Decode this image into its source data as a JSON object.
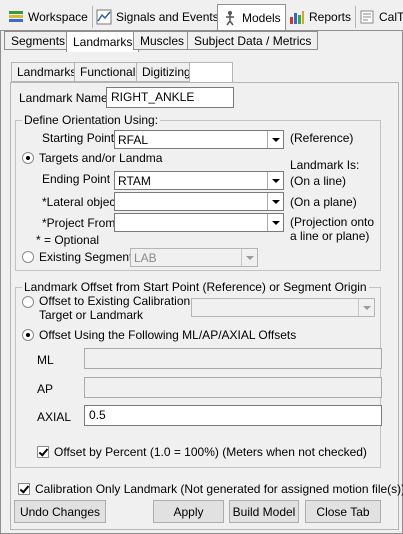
{
  "top_tabs": [
    {
      "label": "Workspace",
      "icon": "workspace-icon"
    },
    {
      "label": "Signals and Events",
      "icon": "signals-icon"
    },
    {
      "label": "Models",
      "icon": "models-icon"
    },
    {
      "label": "Reports",
      "icon": "reports-icon"
    },
    {
      "label": "CalT",
      "icon": "calibration-icon"
    }
  ],
  "model_tabs": [
    "Segments",
    "Landmarks",
    "Muscles",
    "Subject Data / Metrics"
  ],
  "landmark_tabs": [
    "Landmarks",
    "Functional",
    "Digitizing",
    ""
  ],
  "landmark_name": {
    "label": "Landmark Name:",
    "value": "RIGHT_ANKLE"
  },
  "orientation": {
    "legend": "Define Orientation Using:",
    "starting_point": {
      "label": "Starting Point",
      "value": "RFAL",
      "note": "(Reference)"
    },
    "targets_radio": "Targets and/or Landmarks",
    "landmark_is": "Landmark Is:",
    "ending_point": {
      "label": "Ending Point",
      "value": "RTAM",
      "note": "(On a line)"
    },
    "lateral": {
      "label": "*Lateral object",
      "value": "",
      "note": "(On a plane)"
    },
    "project": {
      "label": "*Project From",
      "value": "",
      "note_1": "(Projection onto",
      "note_2": "a line or plane)"
    },
    "optional": "* = Optional",
    "existing_segment": {
      "label": "Existing Segment",
      "value": "LAB"
    }
  },
  "offset": {
    "legend": "Landmark Offset from Start Point (Reference) or Segment Origin",
    "calib_line1": "Offset to Existing Calibration",
    "calib_line2": "Target or Landmark",
    "calib_value": "",
    "ml_ap_axial": "Offset Using the Following ML/AP/AXIAL Offsets",
    "ml": {
      "label": "ML",
      "value": ""
    },
    "ap": {
      "label": "AP",
      "value": ""
    },
    "axial": {
      "label": "AXIAL",
      "value": "0.5"
    },
    "percent": "Offset by Percent (1.0 = 100%) (Meters when not checked)"
  },
  "calibration_only": "Calibration Only Landmark (Not generated for assigned motion file(s))",
  "buttons": {
    "undo": "Undo Changes",
    "apply": "Apply",
    "build": "Build Model",
    "close": "Close Tab"
  },
  "colors": {
    "background": "#f0f0f0",
    "accent_border": "#8f8f8f"
  }
}
